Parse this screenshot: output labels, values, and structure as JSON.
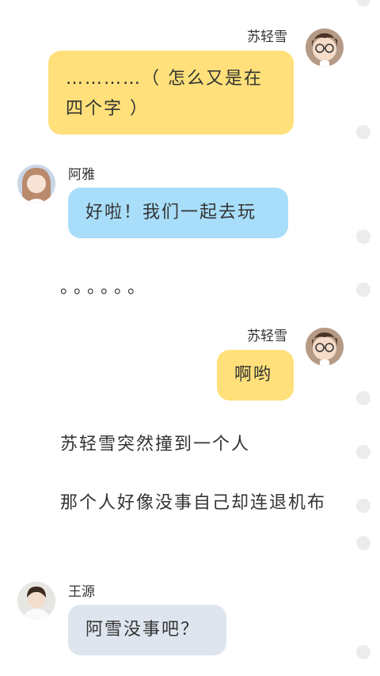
{
  "messages": [
    {
      "sender": "苏轻雪",
      "text": "…………（ 怎么又是在四个字 ）",
      "side": "right",
      "color": "#ffe07a"
    },
    {
      "sender": "阿雅",
      "text": "好啦！我们一起去玩",
      "side": "left",
      "color": "#a8defa"
    },
    {
      "sender": "苏轻雪",
      "text": "啊哟",
      "side": "right",
      "color": "#ffe07a"
    },
    {
      "sender": "王源",
      "text": "阿雪没事吧？",
      "side": "left",
      "color": "#dfe5ee"
    }
  ],
  "narration": {
    "dots": "。。。。。。",
    "line1": "苏轻雪突然撞到一个人",
    "line2": "那个人好像没事自己却连退机布"
  }
}
